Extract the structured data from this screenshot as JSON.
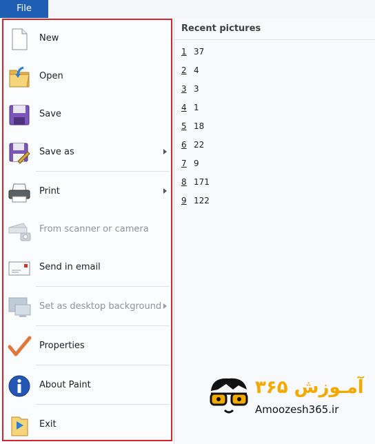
{
  "tabs": {
    "file_label": "File"
  },
  "menu": {
    "items": [
      {
        "label": "New"
      },
      {
        "label": "Open"
      },
      {
        "label": "Save"
      },
      {
        "label": "Save as"
      },
      {
        "label": "Print"
      },
      {
        "label": "From scanner or camera"
      },
      {
        "label": "Send in email"
      },
      {
        "label": "Set as desktop background"
      },
      {
        "label": "Properties"
      },
      {
        "label": "About Paint"
      },
      {
        "label": "Exit"
      }
    ]
  },
  "recent": {
    "title": "Recent pictures",
    "items": [
      {
        "num": "1",
        "name": "37"
      },
      {
        "num": "2",
        "name": "4"
      },
      {
        "num": "3",
        "name": "3"
      },
      {
        "num": "4",
        "name": "1"
      },
      {
        "num": "5",
        "name": "18"
      },
      {
        "num": "6",
        "name": "22"
      },
      {
        "num": "7",
        "name": "9"
      },
      {
        "num": "8",
        "name": "171"
      },
      {
        "num": "9",
        "name": "122"
      }
    ]
  },
  "watermark": {
    "text": "Amoozesh365.ir",
    "title_fa": "آمـوزش ۳۶۵"
  },
  "colors": {
    "file_tab": "#1e5fb3",
    "highlight_border": "#d6232b",
    "logo_accent": "#f2a900"
  }
}
